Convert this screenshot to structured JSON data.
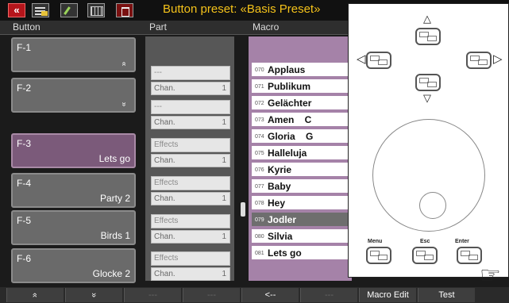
{
  "title": "Button preset: «Basis Preset»",
  "headers": {
    "button": "Button",
    "part": "Part",
    "macro": "Macro"
  },
  "buttons": [
    {
      "id": "F-1",
      "name": "",
      "arrow": "»"
    },
    {
      "id": "F-2",
      "name": "",
      "arrow": "»"
    },
    {
      "id": "F-3",
      "name": "Lets go",
      "arrow": ""
    },
    {
      "id": "F-4",
      "name": "Party 2",
      "arrow": ""
    },
    {
      "id": "F-5",
      "name": "Birds 1",
      "arrow": ""
    },
    {
      "id": "F-6",
      "name": "Glocke 2",
      "arrow": ""
    }
  ],
  "parts": [
    {
      "top": "---",
      "bottom": "Chan.",
      "value": "1"
    },
    {
      "top": "---",
      "bottom": "Chan.",
      "value": "1"
    },
    {
      "top": "Effects",
      "bottom": "Chan.",
      "value": "1"
    },
    {
      "top": "Effects",
      "bottom": "Chan.",
      "value": "1"
    },
    {
      "top": "Effects",
      "bottom": "Chan.",
      "value": "1"
    },
    {
      "top": "Effects",
      "bottom": "Chan.",
      "value": "1"
    }
  ],
  "macros": [
    {
      "num": "070",
      "text": "Applaus"
    },
    {
      "num": "071",
      "text": "Publikum"
    },
    {
      "num": "072",
      "text": "Gelächter"
    },
    {
      "num": "073",
      "text": "Amen    C"
    },
    {
      "num": "074",
      "text": "Gloria    G"
    },
    {
      "num": "075",
      "text": "Halleluja"
    },
    {
      "num": "076",
      "text": "Kyrie"
    },
    {
      "num": "077",
      "text": "Baby"
    },
    {
      "num": "078",
      "text": "Hey"
    },
    {
      "num": "079",
      "text": "Jodler"
    },
    {
      "num": "080",
      "text": "Silvia"
    },
    {
      "num": "081",
      "text": "Lets go"
    }
  ],
  "softkeys": [
    {
      "label": "»",
      "dim": false
    },
    {
      "label": "»",
      "dim": false
    },
    {
      "label": "---",
      "dim": true
    },
    {
      "label": "---",
      "dim": true
    },
    {
      "label": "<--",
      "dim": false
    },
    {
      "label": "---",
      "dim": true
    },
    {
      "label": "Macro Edit",
      "dim": false
    },
    {
      "label": "Test",
      "dim": false
    }
  ],
  "panel": {
    "menu": "Menu",
    "esc": "Esc",
    "enter": "Enter"
  },
  "colors": {
    "title": "#f4c21a",
    "selected": "#7b5a7a",
    "macro_frame": "#a582a8"
  }
}
